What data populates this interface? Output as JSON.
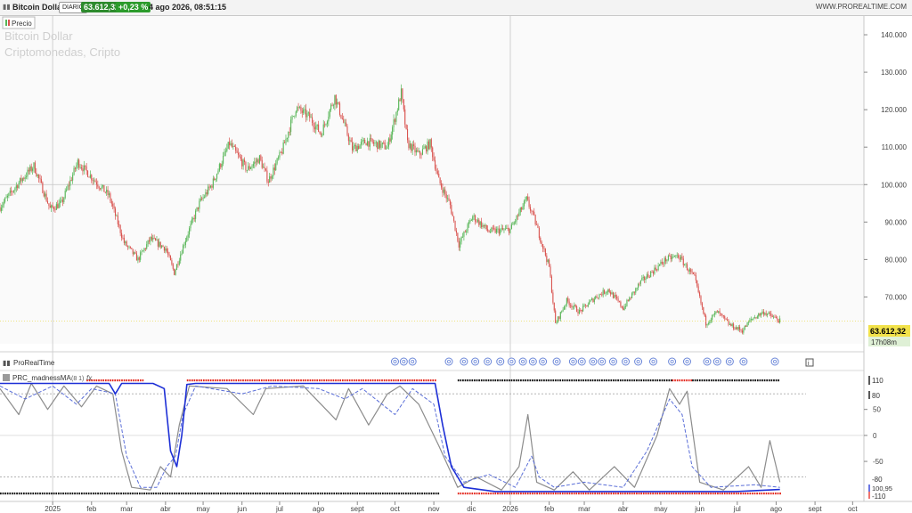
{
  "header": {
    "symbol": "Bitcoin Dollar",
    "timeframe": "DIARIO",
    "last_price": "63.612,32",
    "change": "+0,23 %",
    "datetime": "4 ago 2026, 08:51:15",
    "site": "WWW.PROREALTIME.COM"
  },
  "price_panel": {
    "legend_label": "Precio",
    "watermark_title": "Bitcoin Dollar",
    "watermark_subtitle": "Criptomonedas, Cripto",
    "last_label": "63.612,32",
    "countdown": "17h08m",
    "brand": "ProRealTime"
  },
  "indicator_panel": {
    "name": "PRC_madnessMA",
    "params": "(8 1)",
    "fx_glyph": "fx",
    "value_labels": [
      "110",
      "80",
      "100,95",
      "-80",
      "-110"
    ]
  },
  "colors": {
    "up": "#56b556",
    "down": "#d9534f",
    "blue": "#1d2fd6",
    "blue_dashed": "#5b6fd8",
    "gray": "#8c8c8c",
    "red_marker": "#e42a20",
    "black_marker": "#111111",
    "last_bg": "#f2e24a",
    "change_bg": "#2c9b2c",
    "countdown_bg": "#dff0d6",
    "event_icon": "#6a86d8"
  },
  "icons": {
    "event": "calendar-event-icon",
    "info": "info-icon"
  },
  "chart_data": [
    {
      "type": "candlestick",
      "title": "Bitcoin Dollar",
      "subtitle": "Criptomonedas, Cripto",
      "x_range": [
        "2024-11-20",
        "2026-10-10"
      ],
      "y_range": [
        57500,
        145000
      ],
      "yticks": [
        {
          "v": 140000,
          "label": "140.000"
        },
        {
          "v": 130000,
          "label": "130.000"
        },
        {
          "v": 120000,
          "label": "120.000"
        },
        {
          "v": 110000,
          "label": "110.000"
        },
        {
          "v": 100000,
          "label": "100.000"
        },
        {
          "v": 90000,
          "label": "90.000"
        },
        {
          "v": 80000,
          "label": "80.000"
        },
        {
          "v": 70000,
          "label": "70.000"
        }
      ],
      "xticks": [
        {
          "date": "2025-01-01",
          "label": "2025"
        },
        {
          "date": "2025-02-01",
          "label": "feb"
        },
        {
          "date": "2025-03-01",
          "label": "mar"
        },
        {
          "date": "2025-04-01",
          "label": "abr"
        },
        {
          "date": "2025-05-01",
          "label": "may"
        },
        {
          "date": "2025-06-01",
          "label": "jun"
        },
        {
          "date": "2025-07-01",
          "label": "jul"
        },
        {
          "date": "2025-08-01",
          "label": "ago"
        },
        {
          "date": "2025-09-01",
          "label": "sept"
        },
        {
          "date": "2025-10-01",
          "label": "oct"
        },
        {
          "date": "2025-11-01",
          "label": "nov"
        },
        {
          "date": "2025-12-01",
          "label": "dic"
        },
        {
          "date": "2026-01-01",
          "label": "2026"
        },
        {
          "date": "2026-02-01",
          "label": "feb"
        },
        {
          "date": "2026-03-01",
          "label": "mar"
        },
        {
          "date": "2026-04-01",
          "label": "abr"
        },
        {
          "date": "2026-05-01",
          "label": "may"
        },
        {
          "date": "2026-06-01",
          "label": "jun"
        },
        {
          "date": "2026-07-01",
          "label": "jul"
        },
        {
          "date": "2026-08-01",
          "label": "ago"
        },
        {
          "date": "2026-09-01",
          "label": "sept"
        },
        {
          "date": "2026-10-01",
          "label": "oct"
        }
      ],
      "vertical_lines": [
        "2025-01-01",
        "2026-01-01"
      ],
      "reference_line": 100000,
      "last_value": 63612.32,
      "close_path": [
        [
          "2024-11-20",
          94000
        ],
        [
          "2024-12-05",
          100500
        ],
        [
          "2024-12-17",
          105000
        ],
        [
          "2024-12-30",
          93500
        ],
        [
          "2025-01-08",
          95000
        ],
        [
          "2025-01-21",
          106000
        ],
        [
          "2025-02-01",
          102000
        ],
        [
          "2025-02-15",
          97000
        ],
        [
          "2025-02-27",
          84500
        ],
        [
          "2025-03-10",
          80000
        ],
        [
          "2025-03-20",
          85500
        ],
        [
          "2025-04-01",
          83000
        ],
        [
          "2025-04-08",
          76500
        ],
        [
          "2025-04-16",
          84500
        ],
        [
          "2025-04-28",
          95000
        ],
        [
          "2025-05-08",
          100000
        ],
        [
          "2025-05-22",
          111000
        ],
        [
          "2025-06-05",
          104000
        ],
        [
          "2025-06-15",
          107000
        ],
        [
          "2025-06-22",
          101000
        ],
        [
          "2025-07-03",
          109000
        ],
        [
          "2025-07-14",
          120500
        ],
        [
          "2025-07-25",
          118000
        ],
        [
          "2025-08-03",
          113500
        ],
        [
          "2025-08-14",
          123500
        ],
        [
          "2025-08-28",
          109500
        ],
        [
          "2025-09-08",
          111500
        ],
        [
          "2025-09-25",
          110000
        ],
        [
          "2025-10-06",
          124500
        ],
        [
          "2025-10-11",
          111000
        ],
        [
          "2025-10-20",
          108000
        ],
        [
          "2025-10-29",
          111000
        ],
        [
          "2025-11-05",
          101000
        ],
        [
          "2025-11-14",
          94500
        ],
        [
          "2025-11-21",
          84000
        ],
        [
          "2025-12-02",
          91500
        ],
        [
          "2025-12-15",
          87500
        ],
        [
          "2026-01-01",
          88000
        ],
        [
          "2026-01-14",
          96000
        ],
        [
          "2026-01-20",
          91000
        ],
        [
          "2026-02-01",
          78000
        ],
        [
          "2026-02-06",
          62800
        ],
        [
          "2026-02-15",
          69000
        ],
        [
          "2026-02-25",
          66000
        ],
        [
          "2026-03-10",
          70000
        ],
        [
          "2026-03-20",
          72000
        ],
        [
          "2026-04-01",
          67000
        ],
        [
          "2026-04-15",
          74000
        ],
        [
          "2026-05-05",
          80000
        ],
        [
          "2026-05-15",
          81000
        ],
        [
          "2026-05-28",
          75000
        ],
        [
          "2026-06-06",
          63000
        ],
        [
          "2026-06-15",
          66000
        ],
        [
          "2026-06-25",
          62500
        ],
        [
          "2026-07-05",
          61000
        ],
        [
          "2026-07-12",
          64000
        ],
        [
          "2026-07-22",
          66000
        ],
        [
          "2026-08-04",
          63612
        ]
      ]
    },
    {
      "type": "line",
      "title": "PRC_madnessMA",
      "params": "(8 1)",
      "y_range": [
        -115,
        118
      ],
      "yticks": [
        {
          "v": 110,
          "label": "110"
        },
        {
          "v": 80,
          "label": "80"
        },
        {
          "v": 50,
          "label": "50"
        },
        {
          "v": 0,
          "label": "0"
        },
        {
          "v": -50,
          "label": "-50"
        },
        {
          "v": -80,
          "label": "-80"
        },
        {
          "v": -110,
          "label": "-110"
        }
      ],
      "levels": [
        80,
        -80
      ],
      "last_value_label": "100,95",
      "series": [
        {
          "style": "solid",
          "points": [
            [
              "2024-11-20",
              100
            ],
            [
              "2025-02-15",
              100
            ],
            [
              "2025-02-20",
              80
            ],
            [
              "2025-02-25",
              100
            ],
            [
              "2025-03-22",
              100
            ],
            [
              "2025-03-31",
              90
            ],
            [
              "2025-04-05",
              -30
            ],
            [
              "2025-04-10",
              -60
            ],
            [
              "2025-04-14",
              0
            ],
            [
              "2025-04-18",
              98
            ],
            [
              "2025-04-25",
              100
            ],
            [
              "2025-11-02",
              100
            ],
            [
              "2025-11-08",
              20
            ],
            [
              "2025-11-15",
              -60
            ],
            [
              "2025-11-25",
              -100
            ],
            [
              "2025-12-20",
              -108
            ],
            [
              "2026-03-01",
              -108
            ],
            [
              "2026-06-30",
              -108
            ],
            [
              "2026-08-04",
              -104
            ]
          ]
        },
        {
          "style": "dashed",
          "points": [
            [
              "2024-11-20",
              95
            ],
            [
              "2024-12-10",
              70
            ],
            [
              "2025-01-01",
              95
            ],
            [
              "2025-01-20",
              60
            ],
            [
              "2025-02-01",
              90
            ],
            [
              "2025-02-20",
              80
            ],
            [
              "2025-03-01",
              -40
            ],
            [
              "2025-03-12",
              -100
            ],
            [
              "2025-03-25",
              -100
            ],
            [
              "2025-04-02",
              -60
            ],
            [
              "2025-04-09",
              -40
            ],
            [
              "2025-04-15",
              40
            ],
            [
              "2025-04-25",
              95
            ],
            [
              "2025-06-01",
              80
            ],
            [
              "2025-06-25",
              95
            ],
            [
              "2025-08-01",
              90
            ],
            [
              "2025-08-22",
              70
            ],
            [
              "2025-09-05",
              90
            ],
            [
              "2025-10-01",
              40
            ],
            [
              "2025-10-15",
              90
            ],
            [
              "2025-11-01",
              60
            ],
            [
              "2025-11-10",
              -40
            ],
            [
              "2025-11-25",
              -90
            ],
            [
              "2025-12-15",
              -75
            ],
            [
              "2026-01-05",
              -100
            ],
            [
              "2026-01-18",
              -40
            ],
            [
              "2026-01-24",
              -80
            ],
            [
              "2026-02-05",
              -100
            ],
            [
              "2026-03-01",
              -90
            ],
            [
              "2026-04-01",
              -100
            ],
            [
              "2026-04-20",
              -30
            ],
            [
              "2026-05-08",
              70
            ],
            [
              "2026-05-18",
              40
            ],
            [
              "2026-05-26",
              -60
            ],
            [
              "2026-06-10",
              -100
            ],
            [
              "2026-07-15",
              -95
            ],
            [
              "2026-08-04",
              -100
            ]
          ]
        },
        {
          "style": "gray",
          "points": [
            [
              "2024-11-20",
              90
            ],
            [
              "2024-12-05",
              40
            ],
            [
              "2024-12-15",
              100
            ],
            [
              "2024-12-28",
              50
            ],
            [
              "2025-01-10",
              95
            ],
            [
              "2025-01-24",
              55
            ],
            [
              "2025-02-05",
              95
            ],
            [
              "2025-02-18",
              80
            ],
            [
              "2025-02-25",
              -30
            ],
            [
              "2025-03-05",
              -100
            ],
            [
              "2025-03-20",
              -105
            ],
            [
              "2025-03-28",
              -60
            ],
            [
              "2025-04-05",
              -80
            ],
            [
              "2025-04-12",
              20
            ],
            [
              "2025-04-20",
              95
            ],
            [
              "2025-05-20",
              90
            ],
            [
              "2025-06-10",
              40
            ],
            [
              "2025-06-20",
              90
            ],
            [
              "2025-07-20",
              95
            ],
            [
              "2025-08-15",
              30
            ],
            [
              "2025-08-25",
              90
            ],
            [
              "2025-09-10",
              20
            ],
            [
              "2025-09-25",
              80
            ],
            [
              "2025-10-05",
              95
            ],
            [
              "2025-10-20",
              60
            ],
            [
              "2025-11-05",
              -20
            ],
            [
              "2025-11-20",
              -100
            ],
            [
              "2025-12-05",
              -80
            ],
            [
              "2025-12-25",
              -105
            ],
            [
              "2026-01-08",
              -60
            ],
            [
              "2026-01-15",
              40
            ],
            [
              "2026-01-22",
              -90
            ],
            [
              "2026-02-05",
              -105
            ],
            [
              "2026-02-20",
              -70
            ],
            [
              "2026-03-05",
              -105
            ],
            [
              "2026-03-25",
              -60
            ],
            [
              "2026-04-10",
              -100
            ],
            [
              "2026-04-28",
              0
            ],
            [
              "2026-05-08",
              90
            ],
            [
              "2026-05-16",
              60
            ],
            [
              "2026-05-22",
              85
            ],
            [
              "2026-06-01",
              -90
            ],
            [
              "2026-06-20",
              -105
            ],
            [
              "2026-07-10",
              -60
            ],
            [
              "2026-07-20",
              -100
            ],
            [
              "2026-07-27",
              -10
            ],
            [
              "2026-08-04",
              -90
            ]
          ]
        }
      ],
      "markers": [
        {
          "row": "top",
          "color": "red",
          "from": "2025-01-28",
          "to": "2025-03-15"
        },
        {
          "row": "top",
          "color": "red",
          "from": "2025-04-18",
          "to": "2025-11-02"
        },
        {
          "row": "top",
          "color": "black",
          "from": "2025-11-20",
          "to": "2026-05-10"
        },
        {
          "row": "top",
          "color": "red",
          "from": "2026-05-10",
          "to": "2026-05-26"
        },
        {
          "row": "top",
          "color": "black",
          "from": "2026-05-26",
          "to": "2026-08-04"
        },
        {
          "row": "bottom",
          "color": "black",
          "from": "2024-11-20",
          "to": "2025-11-05"
        },
        {
          "row": "bottom",
          "color": "red",
          "from": "2025-11-20",
          "to": "2026-08-04"
        }
      ],
      "event_dates": [
        "2025-10-01",
        "2025-10-08",
        "2025-10-15",
        "2025-11-13",
        "2025-11-25",
        "2025-12-04",
        "2025-12-14",
        "2025-12-24",
        "2026-01-02",
        "2026-01-11",
        "2026-01-19",
        "2026-01-27",
        "2026-02-07",
        "2026-02-20",
        "2026-02-27",
        "2026-03-08",
        "2026-03-15",
        "2026-03-24",
        "2026-04-03",
        "2026-04-13",
        "2026-04-25",
        "2026-05-10",
        "2026-05-22",
        "2026-06-07",
        "2026-06-15",
        "2026-06-25",
        "2026-07-06",
        "2026-07-31"
      ]
    }
  ]
}
